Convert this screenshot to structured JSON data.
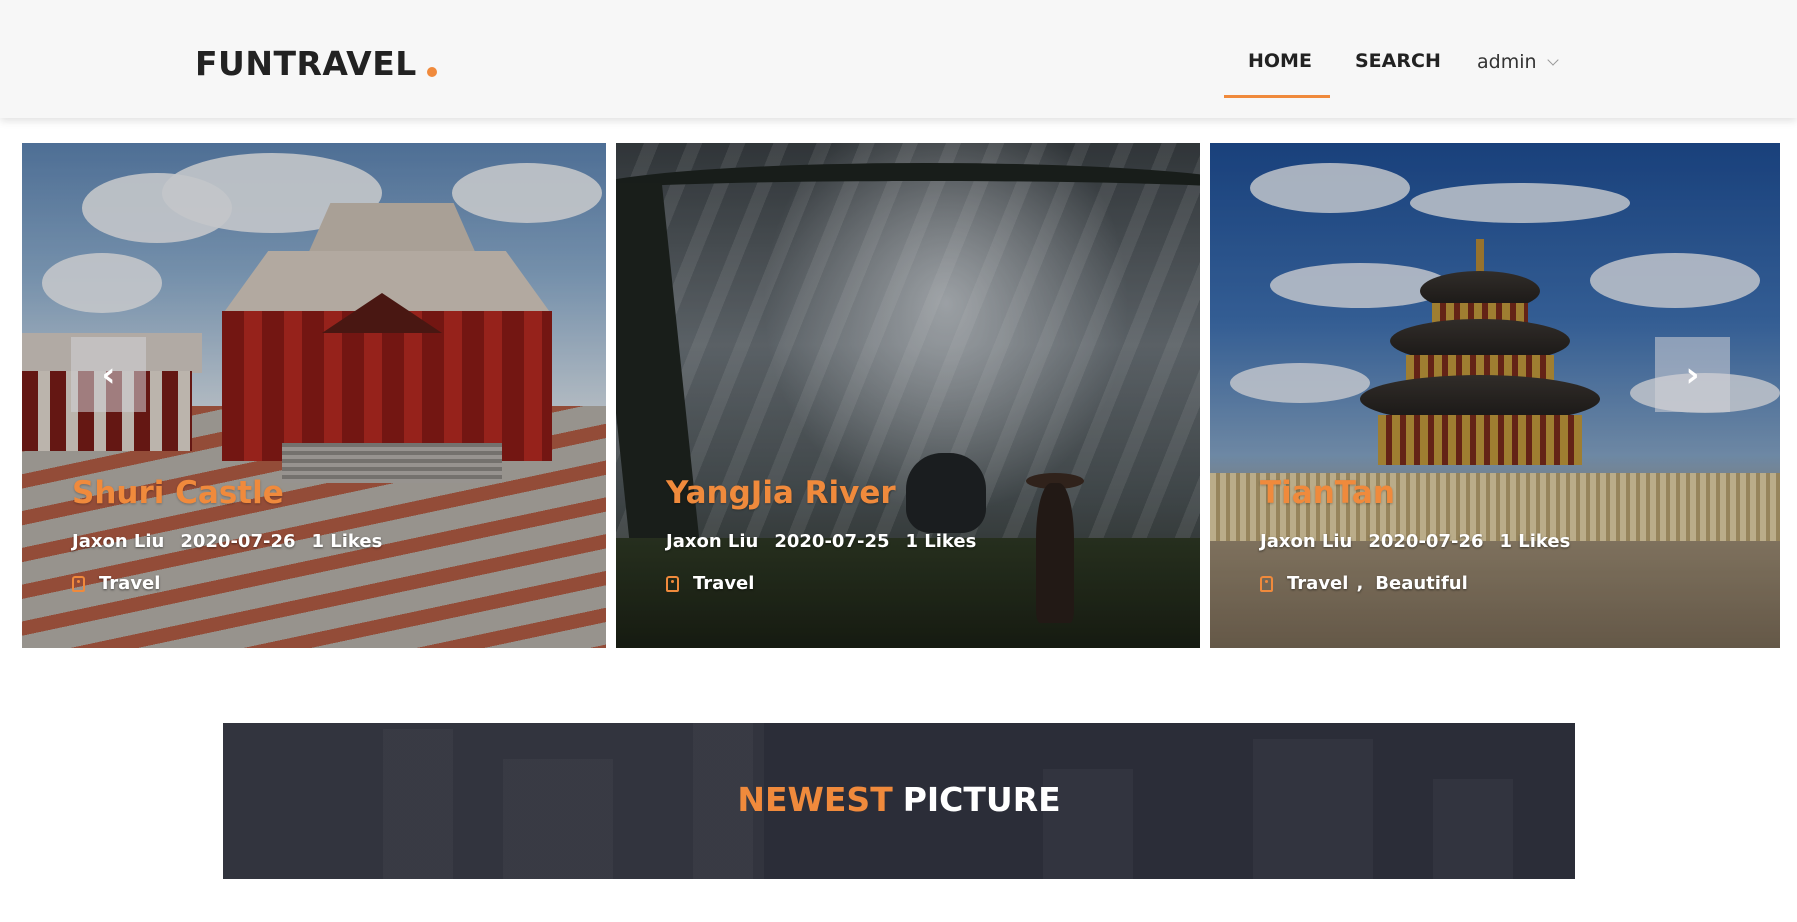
{
  "header": {
    "logo": "FUNTRAVEL",
    "nav": {
      "home": "HOME",
      "search": "SEARCH",
      "user": "admin"
    }
  },
  "carousel": {
    "prev_icon": "chevron-left-icon",
    "next_icon": "chevron-right-icon",
    "prev_glyph": "‹",
    "next_glyph": "›",
    "slides": [
      {
        "title": "Shuri Castle",
        "author": "Jaxon Liu",
        "date": "2020-07-26",
        "likes": "1 Likes",
        "tags": [
          "Travel"
        ]
      },
      {
        "title": "YangJia River",
        "author": "Jaxon Liu",
        "date": "2020-07-25",
        "likes": "1 Likes",
        "tags": [
          "Travel"
        ]
      },
      {
        "title": "TianTan",
        "author": "Jaxon Liu",
        "date": "2020-07-26",
        "likes": "1 Likes",
        "tags": [
          "Travel",
          "Beautiful"
        ],
        "tag_separator": ","
      }
    ]
  },
  "section": {
    "title_accent": "NEWEST",
    "title_rest": "PICTURE"
  },
  "colors": {
    "accent": "#f08a3c",
    "banner_bg": "#2b2d38",
    "header_bg": "#f7f7f7"
  }
}
